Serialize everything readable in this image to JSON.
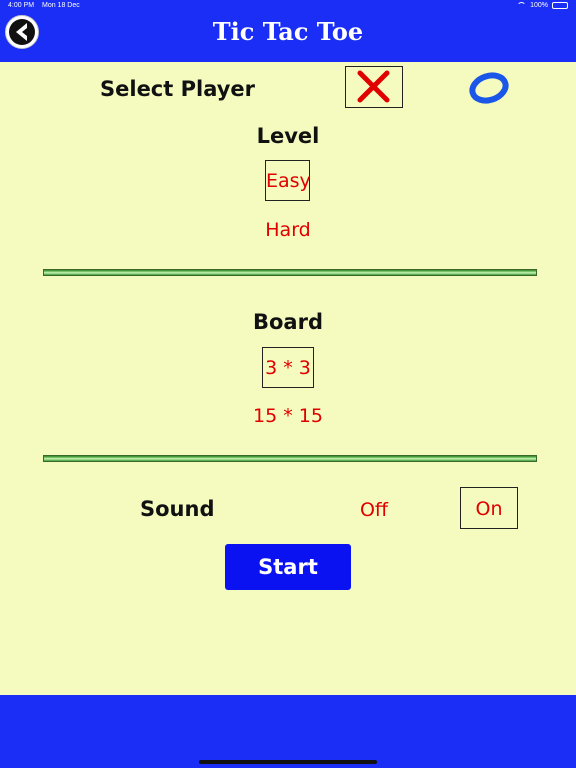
{
  "status_bar": {
    "time": "4:00 PM",
    "date": "Mon 18 Dec",
    "battery": "100%"
  },
  "header": {
    "title": "Tic Tac Toe",
    "back_icon": "chevron-left-icon"
  },
  "player": {
    "label": "Select Player",
    "options": [
      {
        "symbol": "X",
        "icon": "x-mark-icon",
        "selected": true,
        "color": "#e00000"
      },
      {
        "symbol": "O",
        "icon": "o-mark-icon",
        "selected": false,
        "color": "#1a56e8"
      }
    ]
  },
  "level": {
    "label": "Level",
    "options": [
      {
        "label": "Easy",
        "selected": true
      },
      {
        "label": "Hard",
        "selected": false
      }
    ]
  },
  "board": {
    "label": "Board",
    "options": [
      {
        "label": "3 * 3",
        "selected": true
      },
      {
        "label": "15 * 15",
        "selected": false
      }
    ]
  },
  "sound": {
    "label": "Sound",
    "options": [
      {
        "label": "Off",
        "selected": false
      },
      {
        "label": "On",
        "selected": true
      }
    ]
  },
  "start_label": "Start",
  "colors": {
    "background": "#f5fbbf",
    "bar": "#1a2ef5",
    "button": "#0a12f2",
    "option_text": "#e00000"
  }
}
